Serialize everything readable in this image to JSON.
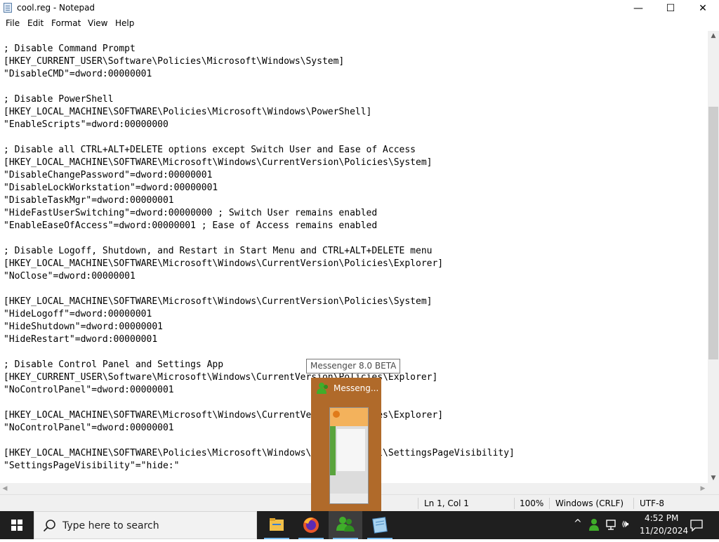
{
  "window": {
    "title": "cool.reg - Notepad",
    "controls": {
      "minimize": "—",
      "maximize": "☐",
      "close": "✕"
    }
  },
  "menu": [
    "File",
    "Edit",
    "Format",
    "View",
    "Help"
  ],
  "editor_lines": [
    "; Disable Command Prompt",
    "[HKEY_CURRENT_USER\\Software\\Policies\\Microsoft\\Windows\\System]",
    "\"DisableCMD\"=dword:00000001",
    "",
    "; Disable PowerShell",
    "[HKEY_LOCAL_MACHINE\\SOFTWARE\\Policies\\Microsoft\\Windows\\PowerShell]",
    "\"EnableScripts\"=dword:00000000",
    "",
    "; Disable all CTRL+ALT+DELETE options except Switch User and Ease of Access",
    "[HKEY_LOCAL_MACHINE\\SOFTWARE\\Microsoft\\Windows\\CurrentVersion\\Policies\\System]",
    "\"DisableChangePassword\"=dword:00000001",
    "\"DisableLockWorkstation\"=dword:00000001",
    "\"DisableTaskMgr\"=dword:00000001",
    "\"HideFastUserSwitching\"=dword:00000000 ; Switch User remains enabled",
    "\"EnableEaseOfAccess\"=dword:00000001 ; Ease of Access remains enabled",
    "",
    "; Disable Logoff, Shutdown, and Restart in Start Menu and CTRL+ALT+DELETE menu",
    "[HKEY_LOCAL_MACHINE\\SOFTWARE\\Microsoft\\Windows\\CurrentVersion\\Policies\\Explorer]",
    "\"NoClose\"=dword:00000001",
    "",
    "[HKEY_LOCAL_MACHINE\\SOFTWARE\\Microsoft\\Windows\\CurrentVersion\\Policies\\System]",
    "\"HideLogoff\"=dword:00000001",
    "\"HideShutdown\"=dword:00000001",
    "\"HideRestart\"=dword:00000001",
    "",
    "; Disable Control Panel and Settings App",
    "[HKEY_CURRENT_USER\\Software\\Microsoft\\Windows\\CurrentVersion\\Policies\\Explorer]",
    "\"NoControlPanel\"=dword:00000001",
    "",
    "[HKEY_LOCAL_MACHINE\\SOFTWARE\\Microsoft\\Windows\\CurrentVersion\\Policies\\Explorer]",
    "\"NoControlPanel\"=dword:00000001",
    "",
    "[HKEY_LOCAL_MACHINE\\SOFTWARE\\Policies\\Microsoft\\Windows\\Control Panel\\SettingsPageVisibility]",
    "\"SettingsPageVisibility\"=\"hide:\""
  ],
  "status": {
    "position": "Ln 1, Col 1",
    "zoom": "100%",
    "line_ending": "Windows (CRLF)",
    "encoding": "UTF-8"
  },
  "taskbar": {
    "search_placeholder": "Type here to search",
    "apps": [
      {
        "name": "file-explorer",
        "icon": "folder-icon"
      },
      {
        "name": "firefox",
        "icon": "firefox-icon"
      },
      {
        "name": "messenger",
        "icon": "messenger-icon",
        "active": true
      },
      {
        "name": "notepad",
        "icon": "notepad-icon"
      }
    ],
    "tray": {
      "chevron": "^",
      "volume": "🕪",
      "time": "4:52 PM",
      "date": "11/20/2024"
    }
  },
  "thumbnail": {
    "title": "Messeng...",
    "tooltip": "Messenger 8.0 BETA"
  },
  "colors": {
    "taskbar": "#1f1f1f",
    "thumbnail_bg": "#b06a2a",
    "active_underline": "#76b9ed"
  }
}
